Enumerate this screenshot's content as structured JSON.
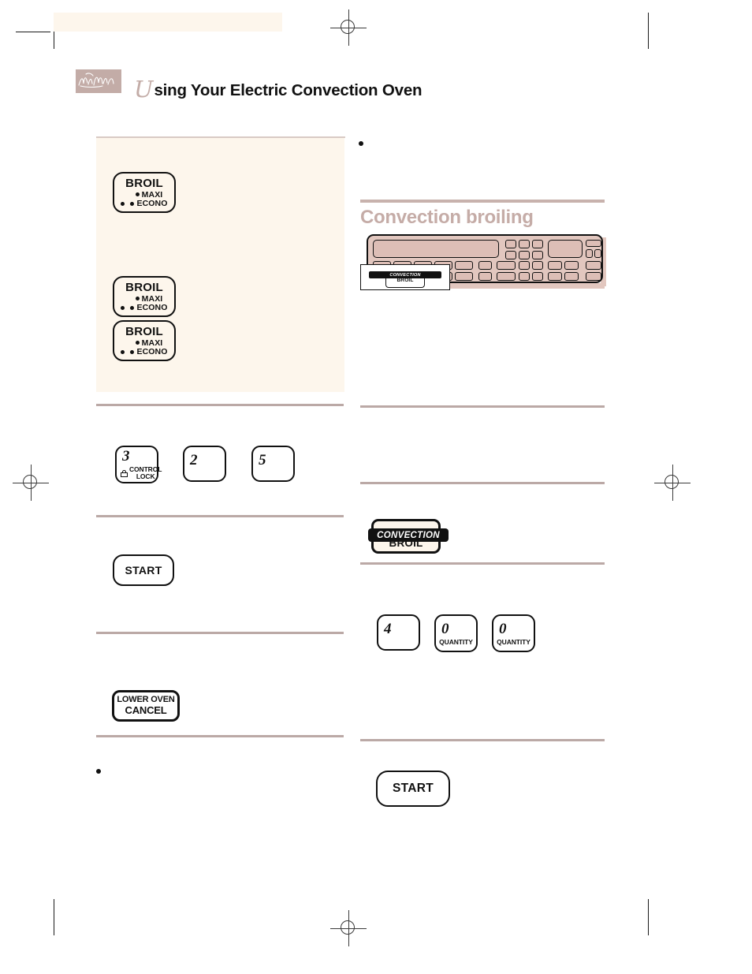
{
  "document": {
    "title": "Using Your Electric Convection Oven",
    "title_dropcap": "U",
    "title_rest": "sing Your Electric Convection Oven",
    "logo_name": "whirlpool-script-logo"
  },
  "colors": {
    "beige_panel": "#fdf6ec",
    "rule_mauve": "#bba9a6",
    "heading_mauve": "#c5aca7",
    "panel_diagram": "#e2c7bf",
    "panel_key": "#ddbeb6",
    "ink": "#111111"
  },
  "left_column": {
    "broil_keys": [
      {
        "title": "BROIL",
        "maxi_label": "MAXI",
        "econo_label": "ECONO",
        "maxi_dots": 1,
        "econo_dots": 2
      },
      {
        "title": "BROIL",
        "maxi_label": "MAXI",
        "econo_label": "ECONO",
        "maxi_dots": 1,
        "econo_dots": 2
      },
      {
        "title": "BROIL",
        "maxi_label": "MAXI",
        "econo_label": "ECONO",
        "maxi_dots": 1,
        "econo_dots": 2
      }
    ],
    "number_keys": [
      {
        "digit": "3",
        "sub": "CONTROL LOCK",
        "sub_line1": "CONTROL",
        "sub_line2": "LOCK",
        "icon": "lock-icon"
      },
      {
        "digit": "2",
        "sub": ""
      },
      {
        "digit": "5",
        "sub": ""
      }
    ],
    "start_button": "START",
    "cancel_button": {
      "line1": "LOWER OVEN",
      "line2": "CANCEL"
    },
    "bullet_note": ""
  },
  "right_column": {
    "bullet_note_top": "",
    "section_heading": "Convection broiling",
    "panel_figure": {
      "name": "oven-control-panel-diagram",
      "callout": {
        "bar_label": "CONVECTION",
        "button_label": "BROIL"
      }
    },
    "convection_broil_key": {
      "bar_label": "CONVECTION",
      "button_label": "BROIL"
    },
    "number_keys": [
      {
        "digit": "4",
        "sub": ""
      },
      {
        "digit": "0",
        "sub": "QUANTITY"
      },
      {
        "digit": "0",
        "sub": "QUANTITY"
      }
    ],
    "start_button": "START"
  }
}
